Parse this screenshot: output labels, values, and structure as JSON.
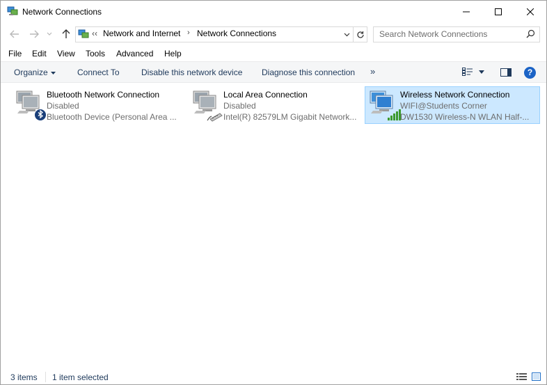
{
  "window": {
    "title": "Network Connections"
  },
  "address_bar": {
    "crumbs": [
      "Network and Internet",
      "Network Connections"
    ],
    "overflow_glyph": "‹‹"
  },
  "search": {
    "placeholder": "Search Network Connections"
  },
  "menu": {
    "items": [
      "File",
      "Edit",
      "View",
      "Tools",
      "Advanced",
      "Help"
    ]
  },
  "commands": {
    "organize": "Organize",
    "connect_to": "Connect To",
    "disable": "Disable this network device",
    "diagnose": "Diagnose this connection",
    "more": "»"
  },
  "connections": [
    {
      "name": "Bluetooth Network Connection",
      "status": "Disabled",
      "device": "Bluetooth Device (Personal Area ...",
      "icon": "bluetooth-network-icon",
      "selected": false
    },
    {
      "name": "Local Area Connection",
      "status": "Disabled",
      "device": "Intel(R) 82579LM Gigabit Network...",
      "icon": "ethernet-network-icon",
      "selected": false
    },
    {
      "name": "Wireless Network Connection",
      "status": "WIFI@Students Corner",
      "device": "DW1530 Wireless-N WLAN Half-...",
      "icon": "wireless-network-icon",
      "selected": true
    }
  ],
  "status_bar": {
    "item_count": "3 items",
    "selection": "1 item selected"
  },
  "colors": {
    "accent": "#1e395b",
    "selection_bg": "#cce8ff",
    "selection_border": "#99d1ff",
    "help_blue": "#1b63c6"
  }
}
